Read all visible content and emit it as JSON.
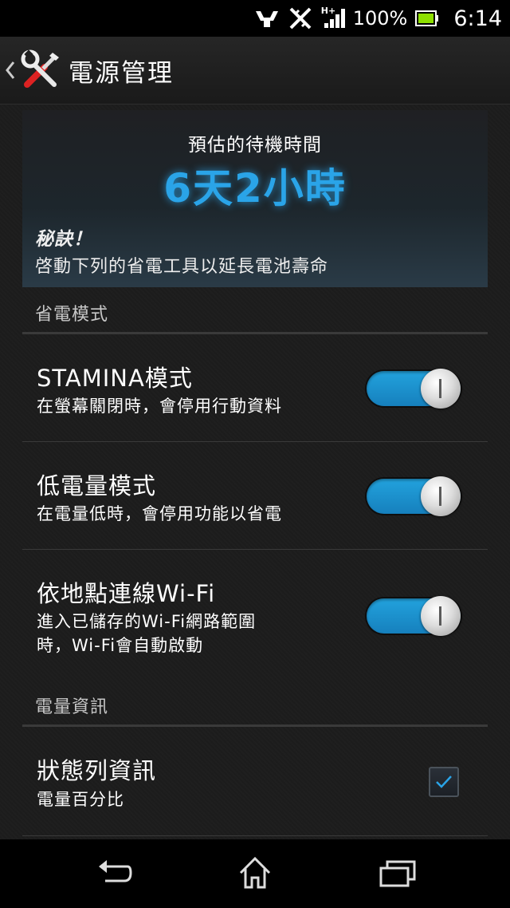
{
  "status_bar": {
    "signal_label": "H+",
    "battery_percent": "100%",
    "time": "6:14"
  },
  "action_bar": {
    "title": "電源管理"
  },
  "estimate": {
    "label": "預估的待機時間",
    "value": "6天2小時",
    "tip_title": "秘訣！",
    "tip_text": "啓動下列的省電工具以延長電池壽命"
  },
  "sections": {
    "power_saving": "省電模式",
    "battery_info": "電量資訊"
  },
  "settings": [
    {
      "title": "STAMINA模式",
      "subtitle": "在螢幕關閉時，會停用行動資料",
      "enabled": true
    },
    {
      "title": "低電量模式",
      "subtitle": "在電量低時，會停用功能以省電",
      "enabled": true
    },
    {
      "title": "依地點連線Wi-Fi",
      "subtitle_line1": "進入已儲存的Wi-Fi網路範圍",
      "subtitle_line2": "時，Wi-Fi會自動啟動",
      "enabled": true
    }
  ],
  "battery_info": [
    {
      "title": "狀態列資訊",
      "subtitle": "電量百分比",
      "checked": true
    }
  ],
  "colors": {
    "accent": "#2aa4e8",
    "toggle_on": "#1f97d6",
    "battery_green": "#8ee000"
  }
}
